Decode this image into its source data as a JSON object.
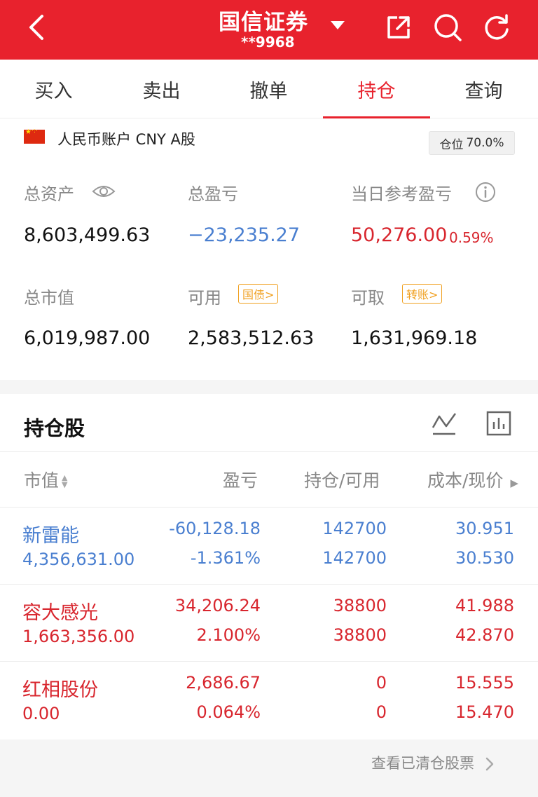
{
  "header": {
    "title": "国信证券",
    "account": "**9968",
    "background": "#e8222d"
  },
  "tabs": [
    {
      "label": "买入"
    },
    {
      "label": "卖出"
    },
    {
      "label": "撤单"
    },
    {
      "label": "持仓",
      "active": true
    },
    {
      "label": "查询"
    }
  ],
  "account": {
    "label": "人民币账户 CNY A股",
    "position_label": "仓位",
    "position_value": "70.0%"
  },
  "stats": {
    "total_assets_label": "总资产",
    "total_assets": "8,603,499.63",
    "total_pnl_label": "总盈亏",
    "total_pnl": "−23,235.27",
    "daily_pnl_label": "当日参考盈亏",
    "daily_pnl": "50,276.00",
    "daily_pnl_pct": "0.59%",
    "market_value_label": "总市值",
    "market_value": "6,019,987.00",
    "available_label": "可用",
    "available_badge": "国债>",
    "available": "2,583,512.63",
    "withdrawable_label": "可取",
    "withdrawable_badge": "转账>",
    "withdrawable": "1,631,969.18"
  },
  "holdings": {
    "title": "持仓股",
    "columns": {
      "market_value": "市值",
      "pnl": "盈亏",
      "position": "持仓/可用",
      "cost_price": "成本/现价"
    },
    "rows": [
      {
        "name": "新雷能",
        "market_value": "4,356,631.00",
        "pnl": "-60,128.18",
        "pnl_pct": "-1.361%",
        "position": "142700",
        "available": "142700",
        "cost": "30.951",
        "price": "30.530",
        "trend": "down"
      },
      {
        "name": "容大感光",
        "market_value": "1,663,356.00",
        "pnl": "34,206.24",
        "pnl_pct": "2.100%",
        "position": "38800",
        "available": "38800",
        "cost": "41.988",
        "price": "42.870",
        "trend": "up"
      },
      {
        "name": "红相股份",
        "market_value": "0.00",
        "pnl": "2,686.67",
        "pnl_pct": "0.064%",
        "position": "0",
        "available": "0",
        "cost": "15.555",
        "price": "15.470",
        "trend": "up"
      }
    ]
  },
  "footer": {
    "cleared_link": "查看已清仓股票"
  },
  "colors": {
    "up": "#d8262e",
    "down": "#4a7fd0",
    "badge": "#f0a020"
  }
}
